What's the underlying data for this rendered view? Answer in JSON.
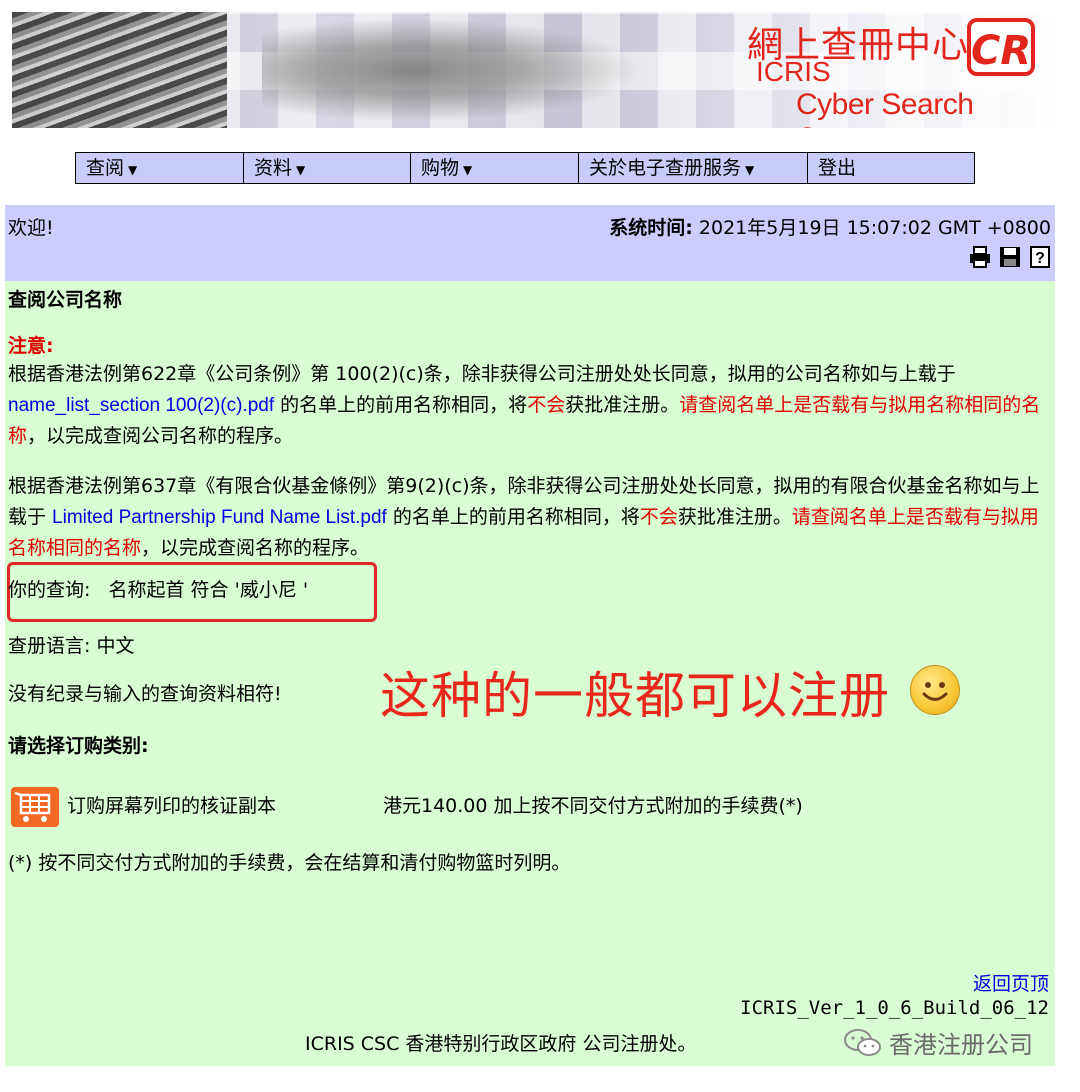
{
  "banner": {
    "cn_title": "網上查冊中心",
    "logo_text": "CR",
    "icris": "ICRIS",
    "subtitle": "Cyber Search Centre"
  },
  "menu": {
    "items": [
      {
        "label": "查阅",
        "has_dropdown": true
      },
      {
        "label": "资料",
        "has_dropdown": true
      },
      {
        "label": "购物",
        "has_dropdown": true
      },
      {
        "label": "关於电子查册服务",
        "has_dropdown": true
      },
      {
        "label": "登出",
        "has_dropdown": false
      }
    ]
  },
  "status": {
    "welcome": "欢迎!",
    "time_label": "系统时间:",
    "time_value": "2021年5月19日 15:07:02 GMT +0800",
    "tools": [
      "print-icon",
      "save-icon",
      "help-icon"
    ]
  },
  "main": {
    "heading": "查阅公司名称",
    "notice_label": "注意:",
    "para1": {
      "t1": "根据香港法例第622章《公司条例》第 100(2)(c)条，除非获得公司注册处处长同意，拟用的公司名称如与上载于 ",
      "link": "name_list_section 100(2)(c).pdf",
      "t2": " 的名单上的前用名称相同，将",
      "red1": "不会",
      "t3": "获批准注册。",
      "red2": "请查阅名单上是否载有与拟用名称相同的名称",
      "t4": "，以完成查阅公司名称的程序。"
    },
    "para2": {
      "t1": "根据香港法例第637章《有限合伙基金條例》第9(2)(c)条，除非获得公司注册处处长同意，拟用的有限合伙基金名称如与上载于 ",
      "link": "Limited Partnership Fund Name List.pdf",
      "t2": " 的名单上的前用名称相同，将",
      "red1": "不会",
      "t3": "获批准注册。",
      "red2": "请查阅名单上是否载有与拟用名称相同的名称",
      "t4": "，以完成查阅名称的程序。"
    },
    "query": "你的查询:   名称起首 符合 '威小尼 '",
    "language": "查册语言: 中文",
    "no_record": "没有纪录与输入的查询资料相符!",
    "annotation": "这种的一般都可以注册",
    "order_heading": "请选择订购类别:",
    "order_item": "订购屏幕列印的核证副本",
    "order_price": "港元140.00 加上按不同交付方式附加的手续费(*)",
    "footnote": "(*) 按不同交付方式附加的手续费，会在结算和清付购物篮时列明。",
    "back_link": "返回页顶",
    "build": "ICRIS_Ver_1_0_6_Build_06_12",
    "copyright": "ICRIS CSC 香港特别行政区政府 公司注册处。",
    "watermark": "香港注册公司"
  }
}
